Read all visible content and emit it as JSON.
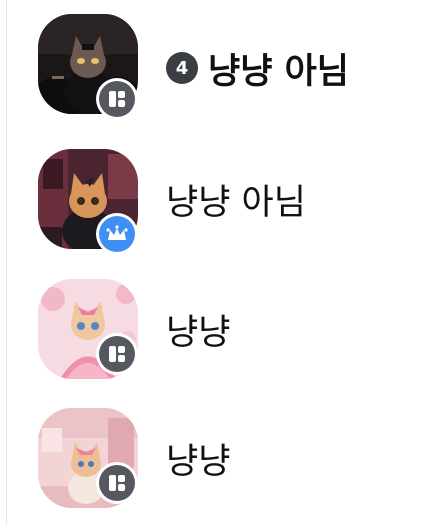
{
  "colors": {
    "badge_dark": "#55585e",
    "badge_blue": "#3f8ff5",
    "count_badge": "#3a3d42",
    "text": "#111111"
  },
  "items": [
    {
      "name": "냥냥 아님",
      "unread_count": "4",
      "bold": true,
      "avatar": "black-cat-dark-room-avatar",
      "badge_icon": "mini-app-icon"
    },
    {
      "name": "냥냥 아님",
      "bold": false,
      "avatar": "cat-red-room-avatar",
      "badge_icon": "crown-icon"
    },
    {
      "name": "냥냥",
      "bold": false,
      "avatar": "pink-dress-cat-avatar",
      "badge_icon": "mini-app-icon"
    },
    {
      "name": "냥냥",
      "bold": false,
      "avatar": "pink-room-cat-avatar",
      "badge_icon": "mini-app-icon"
    }
  ]
}
